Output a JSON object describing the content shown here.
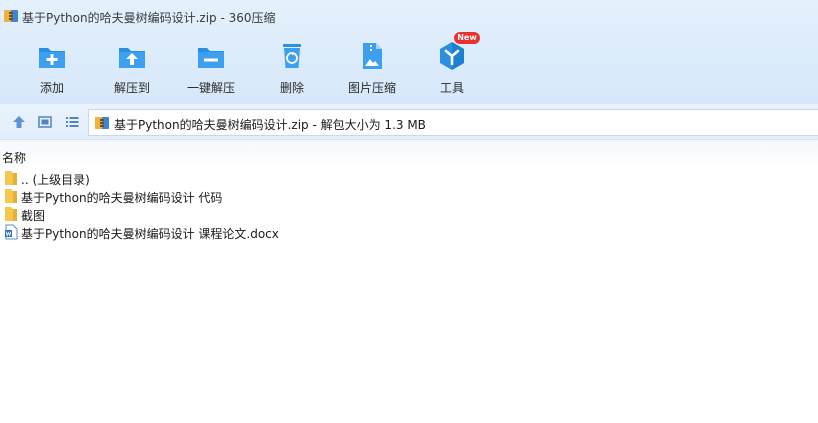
{
  "window": {
    "title": "基于Python的哈夫曼树编码设计.zip - 360压缩",
    "icon": "archive-icon"
  },
  "toolbar": {
    "items": [
      {
        "label": "添加",
        "icon": "add-folder-icon"
      },
      {
        "label": "解压到",
        "icon": "extract-to-folder-icon"
      },
      {
        "label": "一键解压",
        "icon": "one-click-extract-icon"
      },
      {
        "label": "删除",
        "icon": "recycle-bin-icon"
      },
      {
        "label": "图片压缩",
        "icon": "image-compress-icon"
      },
      {
        "label": "工具",
        "icon": "tools-icon"
      }
    ],
    "badge": "New"
  },
  "address_bar": {
    "text": "基于Python的哈夫曼树编码设计.zip - 解包大小为 1.3 MB"
  },
  "file_list": {
    "column_name": "名称",
    "rows": [
      {
        "name": ".. (上级目录)",
        "icon": "folder-icon"
      },
      {
        "name": "基于Python的哈夫曼树编码设计 代码",
        "icon": "folder-icon"
      },
      {
        "name": "截图",
        "icon": "folder-icon"
      },
      {
        "name": "基于Python的哈夫曼树编码设计 课程论文.docx",
        "icon": "word-document-icon"
      }
    ]
  },
  "colors": {
    "accent_blue": "#2a8fe0",
    "toolbar_bg": "#d6e8fa",
    "badge_red": "#e8322f",
    "folder_yellow": "#f5c84c"
  }
}
